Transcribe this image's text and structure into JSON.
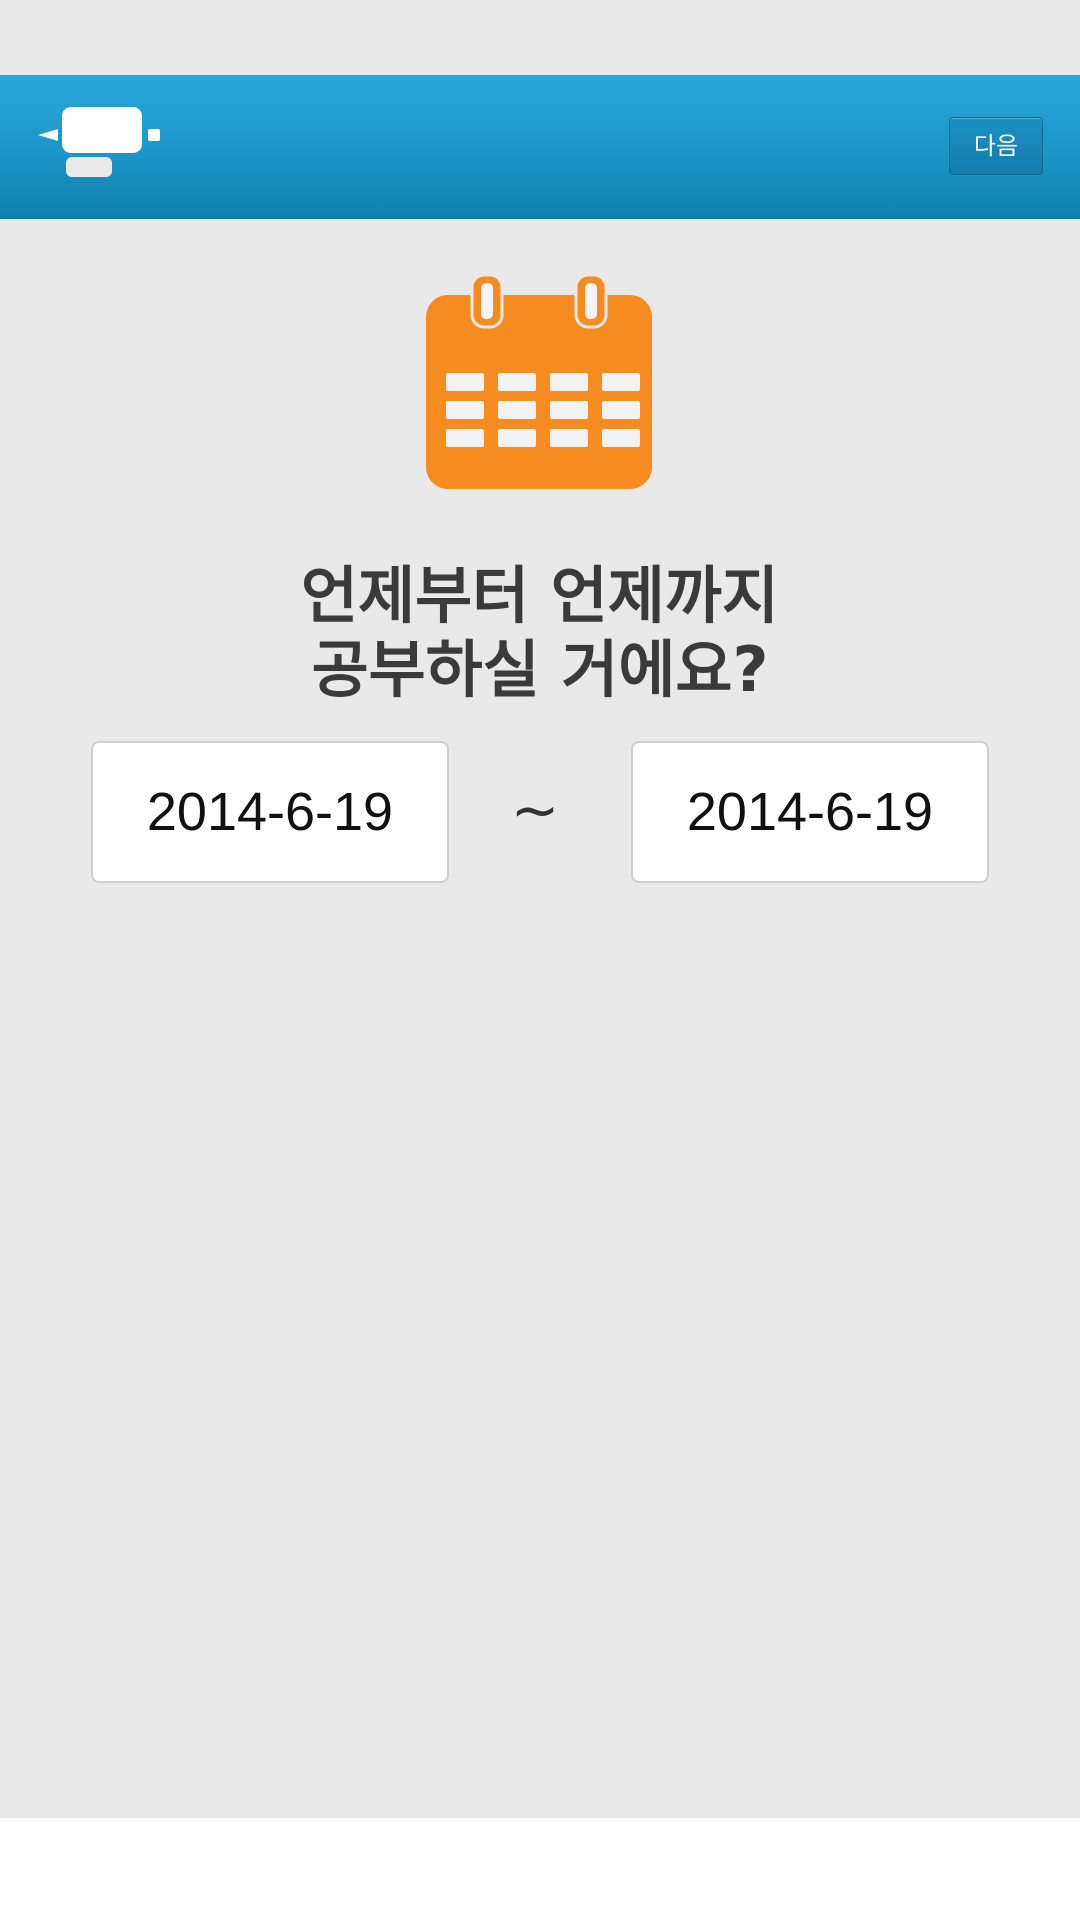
{
  "header": {
    "logo_icon": "monitor-icon",
    "next_label": "다음",
    "color": "#1c95c8"
  },
  "main": {
    "calendar_icon": "calendar-icon",
    "calendar_color": "#f68b1f",
    "question_line1": "언제부터 언제까지",
    "question_line2": "공부하실 거에요?",
    "start_date": "2014-6-19",
    "separator": "~",
    "end_date": "2014-6-19"
  }
}
